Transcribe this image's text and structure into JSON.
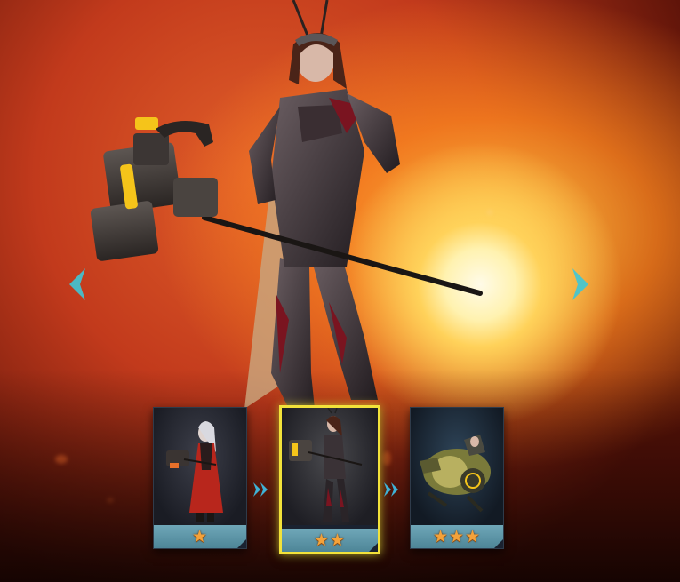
{
  "scene": {
    "description_icon": "hero-showcase",
    "accent_color": "#3fc7d6",
    "selected_border_color": "#f2e23a",
    "star_color": "#f4a23a"
  },
  "navigation": {
    "prev_icon": "chevron-left-icon",
    "next_icon": "chevron-right-icon"
  },
  "skins": [
    {
      "stars": "★",
      "selected": false,
      "icon": "red-dress-hero-portrait"
    },
    {
      "stars": "★★",
      "selected": true,
      "icon": "armored-hero-portrait"
    },
    {
      "stars": "★★★",
      "selected": false,
      "icon": "mech-suit-portrait"
    }
  ],
  "progression_arrows": [
    "double-chevron-right-icon",
    "double-chevron-right-icon"
  ]
}
